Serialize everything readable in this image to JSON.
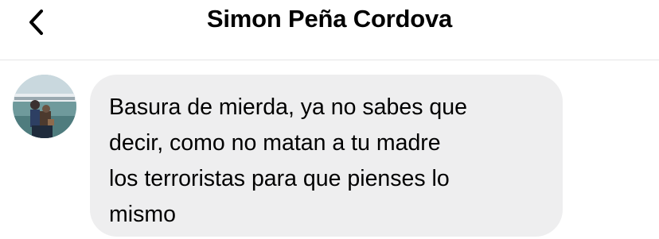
{
  "header": {
    "title": "Simon Peña Cordova",
    "back_icon": "chevron-left-icon"
  },
  "conversation": {
    "messages": [
      {
        "sender": "incoming",
        "avatar": "contact-avatar-photo",
        "text": "Basura de mierda, ya no sabes que\ndecir, como no matan a tu madre\nlos terroristas para que pienses lo\nmismo"
      }
    ]
  },
  "colors": {
    "bubble_background": "#eeeeef",
    "divider": "#e4e4e6",
    "text": "#000000",
    "background": "#ffffff"
  }
}
